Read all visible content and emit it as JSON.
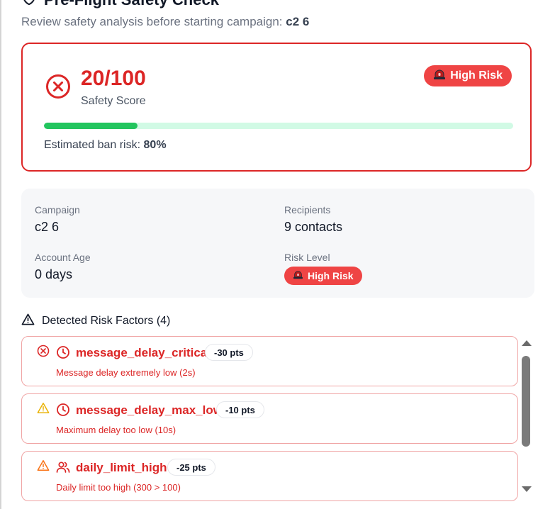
{
  "header": {
    "title": "Pre-Flight Safety Check",
    "subtitle_prefix": "Review safety analysis before starting campaign:",
    "campaign_name": "c2 6"
  },
  "score": {
    "value": "20/100",
    "label": "Safety Score",
    "badge": "High Risk",
    "progress_percent": 20,
    "ban_risk_label": "Estimated ban risk:",
    "ban_risk_value": "80%"
  },
  "info": {
    "campaign_label": "Campaign",
    "campaign_value": "c2 6",
    "recipients_label": "Recipients",
    "recipients_value": "9 contacts",
    "account_age_label": "Account Age",
    "account_age_value": "0 days",
    "risk_level_label": "Risk Level",
    "risk_level_value": "High Risk"
  },
  "factors": {
    "heading": "Detected Risk Factors (4)",
    "items": [
      {
        "name": "message_delay_critical",
        "points": "-30 pts",
        "description": "Message delay extremely low (2s)",
        "status_icon": "x-circle-icon",
        "type_icon": "clock-icon"
      },
      {
        "name": "message_delay_max_low",
        "points": "-10 pts",
        "description": "Maximum delay too low (10s)",
        "status_icon": "warning-triangle-icon",
        "type_icon": "clock-icon"
      },
      {
        "name": "daily_limit_high",
        "points": "-25 pts",
        "description": "Daily limit too high (300 > 100)",
        "status_icon": "warning-triangle-icon",
        "type_icon": "users-icon"
      }
    ]
  },
  "colors": {
    "danger": "#dc2626",
    "badge": "#ef4444",
    "success": "#22c55e",
    "warning_yellow": "#eab308",
    "warning_orange": "#f97316"
  }
}
